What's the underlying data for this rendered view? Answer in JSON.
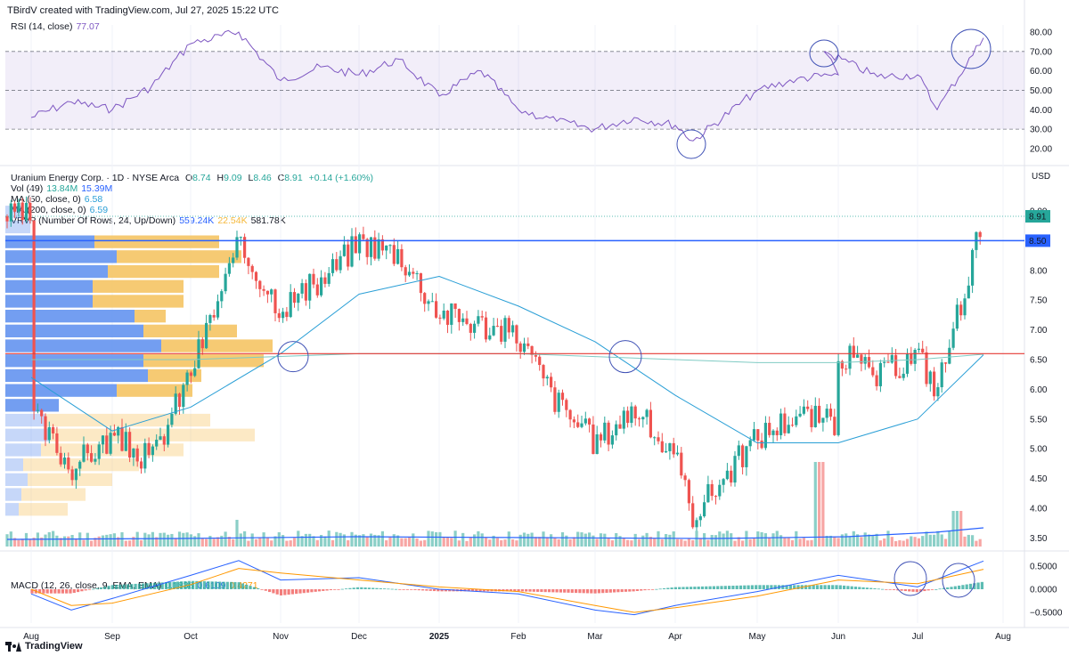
{
  "header": {
    "credit": "TBirdV created with TradingView.com, Jul 27, 2025 15:22 UTC"
  },
  "rsi": {
    "label": "RSI (14, close)",
    "value": "77.07",
    "ticks": [
      "80.00",
      "70.00",
      "60.00",
      "50.00",
      "40.00",
      "30.00",
      "20.00"
    ]
  },
  "price": {
    "symbol": "Uranium Energy Corp. · 1D · NYSE Arca",
    "o_label": "O",
    "o": "8.74",
    "h_label": "H",
    "h": "9.09",
    "l_label": "L",
    "l": "8.46",
    "c_label": "C",
    "c": "8.91",
    "change": "+0.14 (+1.60%)",
    "vol_label": "Vol (49)",
    "vol1": "13.84M",
    "vol2": "15.39M",
    "ma50_label": "MA (50, close, 0)",
    "ma50": "6.58",
    "ma200_label": "MA (200, close, 0)",
    "ma200": "6.59",
    "vrvp_label": "VRVP (Number Of Rows, 24, Up/Down)",
    "vrvp_up": "559.24K",
    "vrvp_down": "22.54K",
    "vrvp_total": "581.78K",
    "currency": "USD",
    "last_price_tag": "8.91",
    "level_tag": "8.50",
    "ticks": [
      "9.00",
      "8.50",
      "8.00",
      "7.50",
      "7.00",
      "6.50",
      "6.00",
      "5.50",
      "5.00",
      "4.50",
      "4.00",
      "3.50"
    ]
  },
  "macd": {
    "label": "MACD (12, 26, close, 9, EMA, EMA)",
    "v1": "0.1838",
    "v2": "0.6109",
    "v3": "0.4271",
    "ticks": [
      "0.5000",
      "0.0000",
      "−0.5000"
    ]
  },
  "time_axis": [
    "Aug",
    "Sep",
    "Oct",
    "Nov",
    "Dec",
    "2025",
    "Feb",
    "Mar",
    "Apr",
    "May",
    "Jun",
    "Jul",
    "Aug"
  ],
  "footer": {
    "brand": "TradingView"
  },
  "colors": {
    "up": "#26a69a",
    "down": "#ef5350",
    "ma50": "#2a9fd6",
    "resistance_line": "#2962ff",
    "support_line": "#e53935",
    "rsi_line": "#7e57c2",
    "macd_line": "#2962ff",
    "signal_line": "#ff9800",
    "vrvp_up": "#5b8def",
    "vrvp_down": "#f5c15a"
  },
  "chart_data": [
    {
      "type": "line",
      "title": "RSI (14, close)",
      "y_range": [
        20,
        85
      ],
      "reference_lines": [
        70,
        50,
        30
      ],
      "series": [
        {
          "name": "RSI",
          "x": [
            "Aug",
            "mid-Aug",
            "Sep",
            "mid-Sep",
            "Oct",
            "Oct 15",
            "Nov",
            "mid-Nov",
            "Dec",
            "mid-Dec",
            "2025",
            "mid-Jan",
            "Feb",
            "mid-Feb",
            "Mar",
            "mid-Mar",
            "Apr",
            "Apr 7",
            "May",
            "mid-May",
            "Jun",
            "Jun 1",
            "mid-Jun",
            "Jul",
            "Jul 10",
            "Jul 25"
          ],
          "values": [
            36,
            44,
            40,
            52,
            74,
            80,
            55,
            62,
            58,
            66,
            47,
            60,
            40,
            34,
            30,
            36,
            32,
            24,
            50,
            56,
            58,
            70,
            57,
            58,
            40,
            77
          ]
        }
      ]
    },
    {
      "type": "candlestick",
      "title": "Uranium Energy Corp. · 1D · NYSE Arca",
      "y_range": [
        3.4,
        9.3
      ],
      "horizontal_levels": [
        8.5,
        6.6
      ],
      "series": [
        {
          "name": "Close",
          "x": [
            "Aug",
            "mid-Aug",
            "Sep",
            "mid-Sep",
            "Oct",
            "Oct 15",
            "Nov",
            "mid-Nov",
            "Dec",
            "mid-Dec",
            "2025",
            "mid-Jan",
            "Feb",
            "mid-Feb",
            "Mar",
            "mid-Mar",
            "Apr",
            "Apr 7",
            "May",
            "mid-May",
            "Jun",
            "Jun 1",
            "mid-Jun",
            "Jul",
            "Jul 10",
            "Jul 25"
          ],
          "values": [
            5.6,
            4.7,
            5.2,
            4.8,
            6.3,
            8.4,
            7.4,
            7.8,
            8.5,
            8.3,
            7.3,
            7.1,
            6.9,
            5.8,
            5.1,
            5.7,
            4.8,
            3.9,
            5.2,
            5.6,
            5.4,
            6.8,
            6.2,
            6.6,
            6.0,
            8.91
          ]
        },
        {
          "name": "MA (50, close, 0)",
          "x": [
            "Aug",
            "Sep",
            "Oct",
            "Nov",
            "Dec",
            "2025",
            "Feb",
            "Mar",
            "Apr",
            "May",
            "Jun",
            "Jul",
            "Jul 25"
          ],
          "values": [
            6.2,
            5.3,
            5.7,
            6.6,
            7.6,
            7.9,
            7.4,
            6.8,
            5.9,
            5.1,
            5.1,
            5.5,
            6.58
          ]
        },
        {
          "name": "MA (200, close, 0)",
          "x": [
            "Aug",
            "Oct",
            "Dec",
            "Feb",
            "Mar",
            "Apr",
            "May",
            "Jun",
            "Jul",
            "Jul 25"
          ],
          "values": [
            6.5,
            6.5,
            6.6,
            6.6,
            6.55,
            6.5,
            6.45,
            6.45,
            6.5,
            6.59
          ]
        }
      ]
    },
    {
      "type": "bar",
      "title": "VRVP (Number Of Rows, 24, Up/Down)",
      "categories": [
        "9.0",
        "8.75",
        "8.5",
        "8.25",
        "8.0",
        "7.75",
        "7.5",
        "7.25",
        "7.0",
        "6.75",
        "6.5",
        "6.25",
        "6.0",
        "5.75",
        "5.5",
        "5.25",
        "5.0",
        "4.75",
        "4.5",
        "4.25",
        "4.0"
      ],
      "series": [
        {
          "name": "Up",
          "values": [
            20,
            28,
            100,
            125,
            115,
            98,
            98,
            145,
            155,
            175,
            155,
            160,
            125,
            60,
            45,
            50,
            40,
            20,
            25,
            18,
            15
          ]
        },
        {
          "name": "Down",
          "values": [
            0,
            0,
            240,
            265,
            240,
            200,
            200,
            180,
            260,
            300,
            290,
            220,
            210,
            60,
            230,
            280,
            200,
            150,
            120,
            90,
            70
          ]
        }
      ]
    },
    {
      "type": "line",
      "title": "MACD (12, 26, close, 9, EMA, EMA)",
      "y_range": [
        -0.65,
        0.7
      ],
      "series": [
        {
          "name": "MACD",
          "x": [
            "Aug",
            "mid-Aug",
            "Sep",
            "Oct",
            "Oct 15",
            "Nov",
            "Dec",
            "2025",
            "Feb",
            "Mar",
            "mid-Mar",
            "Apr",
            "May",
            "Jun",
            "Jul",
            "Jul 25"
          ],
          "values": [
            -0.1,
            -0.45,
            -0.2,
            0.3,
            0.62,
            0.2,
            0.25,
            0.0,
            -0.1,
            -0.45,
            -0.55,
            -0.35,
            -0.05,
            0.3,
            0.05,
            0.61
          ]
        },
        {
          "name": "Signal",
          "x": [
            "Aug",
            "mid-Aug",
            "Sep",
            "Oct",
            "Oct 15",
            "Nov",
            "Dec",
            "2025",
            "Feb",
            "Mar",
            "mid-Mar",
            "Apr",
            "May",
            "Jun",
            "Jul",
            "Jul 25"
          ],
          "values": [
            0.0,
            -0.35,
            -0.3,
            0.1,
            0.45,
            0.35,
            0.2,
            0.05,
            -0.05,
            -0.35,
            -0.5,
            -0.4,
            -0.15,
            0.2,
            0.12,
            0.43
          ]
        }
      ]
    }
  ]
}
